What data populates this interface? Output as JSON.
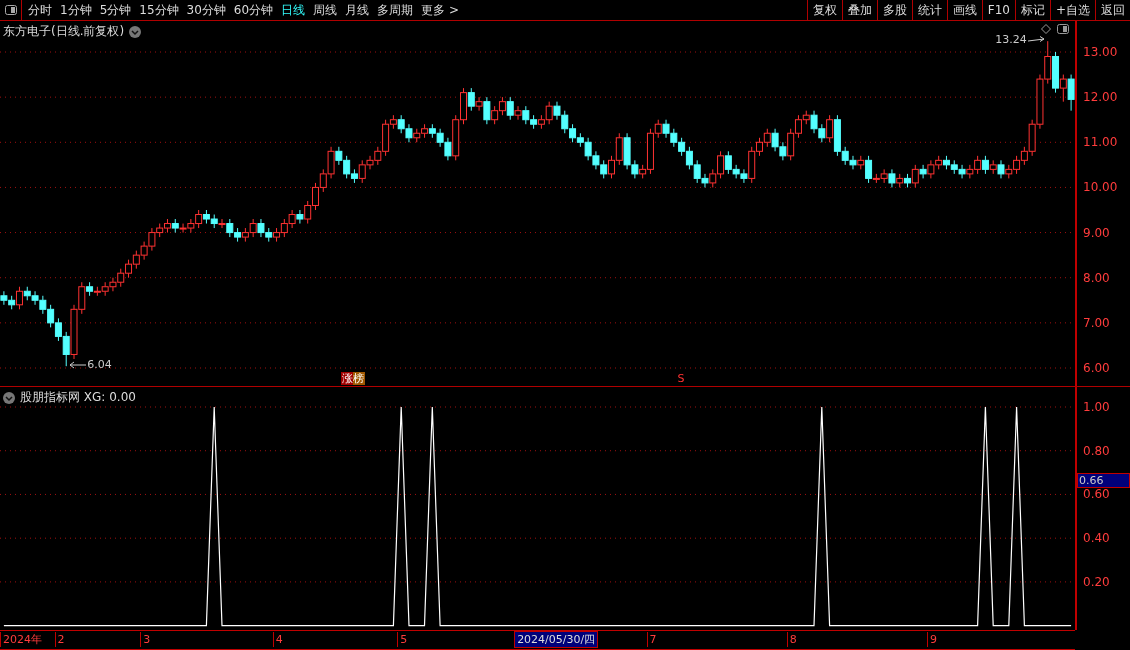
{
  "toolbar": {
    "tabs": [
      {
        "label": "分时",
        "selected": false
      },
      {
        "label": "1分钟",
        "selected": false
      },
      {
        "label": "5分钟",
        "selected": false
      },
      {
        "label": "15分钟",
        "selected": false
      },
      {
        "label": "30分钟",
        "selected": false
      },
      {
        "label": "60分钟",
        "selected": false
      },
      {
        "label": "日线",
        "selected": true
      },
      {
        "label": "周线",
        "selected": false
      },
      {
        "label": "月线",
        "selected": false
      },
      {
        "label": "多周期",
        "selected": false
      },
      {
        "label": "更多 >",
        "selected": false
      }
    ],
    "buttons": [
      "复权",
      "叠加",
      "多股",
      "统计",
      "画线",
      "F10",
      "标记",
      "+自选",
      "返回"
    ]
  },
  "main_chart": {
    "title": "东方电子(日线.前复权)",
    "chart_data": {
      "type": "candlestick",
      "ylim": [
        6,
        13
      ],
      "grid": true,
      "yticks": [
        {
          "value": 13,
          "label": "13.00"
        },
        {
          "value": 12,
          "label": "12.00"
        },
        {
          "value": 11,
          "label": "11.00"
        },
        {
          "value": 10,
          "label": "10.00"
        },
        {
          "value": 9,
          "label": "9.00"
        },
        {
          "value": 8,
          "label": "8.00"
        },
        {
          "value": 7,
          "label": "7.00"
        },
        {
          "value": 6,
          "label": "6.00"
        }
      ],
      "ohlc": [
        [
          7.6,
          7.7,
          7.4,
          7.5
        ],
        [
          7.5,
          7.6,
          7.3,
          7.4
        ],
        [
          7.4,
          7.8,
          7.3,
          7.7
        ],
        [
          7.7,
          7.8,
          7.5,
          7.6
        ],
        [
          7.6,
          7.7,
          7.4,
          7.5
        ],
        [
          7.5,
          7.6,
          7.2,
          7.3
        ],
        [
          7.3,
          7.4,
          6.9,
          7.0
        ],
        [
          7.0,
          7.1,
          6.6,
          6.7
        ],
        [
          6.7,
          6.8,
          6.04,
          6.3
        ],
        [
          6.3,
          7.4,
          6.2,
          7.3
        ],
        [
          7.3,
          7.9,
          7.2,
          7.8
        ],
        [
          7.8,
          7.9,
          7.6,
          7.7
        ],
        [
          7.7,
          7.8,
          7.6,
          7.7
        ],
        [
          7.7,
          7.9,
          7.6,
          7.8
        ],
        [
          7.8,
          8.0,
          7.7,
          7.9
        ],
        [
          7.9,
          8.2,
          7.8,
          8.1
        ],
        [
          8.1,
          8.4,
          8.0,
          8.3
        ],
        [
          8.3,
          8.6,
          8.2,
          8.5
        ],
        [
          8.5,
          8.8,
          8.4,
          8.7
        ],
        [
          8.7,
          9.1,
          8.6,
          9.0
        ],
        [
          9.0,
          9.2,
          8.9,
          9.1
        ],
        [
          9.1,
          9.3,
          9.0,
          9.2
        ],
        [
          9.2,
          9.3,
          9.0,
          9.1
        ],
        [
          9.1,
          9.2,
          9.0,
          9.1
        ],
        [
          9.1,
          9.3,
          9.0,
          9.2
        ],
        [
          9.2,
          9.5,
          9.1,
          9.4
        ],
        [
          9.4,
          9.5,
          9.2,
          9.3
        ],
        [
          9.3,
          9.4,
          9.1,
          9.2
        ],
        [
          9.2,
          9.3,
          9.1,
          9.2
        ],
        [
          9.2,
          9.3,
          8.9,
          9.0
        ],
        [
          9.0,
          9.1,
          8.8,
          8.9
        ],
        [
          8.9,
          9.1,
          8.8,
          9.0
        ],
        [
          9.0,
          9.3,
          8.9,
          9.2
        ],
        [
          9.2,
          9.3,
          8.9,
          9.0
        ],
        [
          9.0,
          9.1,
          8.8,
          8.9
        ],
        [
          8.9,
          9.1,
          8.8,
          9.0
        ],
        [
          9.0,
          9.3,
          8.9,
          9.2
        ],
        [
          9.2,
          9.5,
          9.1,
          9.4
        ],
        [
          9.4,
          9.5,
          9.2,
          9.3
        ],
        [
          9.3,
          9.7,
          9.2,
          9.6
        ],
        [
          9.6,
          10.1,
          9.5,
          10.0
        ],
        [
          10.0,
          10.4,
          9.9,
          10.3
        ],
        [
          10.3,
          10.9,
          10.2,
          10.8
        ],
        [
          10.8,
          10.9,
          10.5,
          10.6
        ],
        [
          10.6,
          10.7,
          10.2,
          10.3
        ],
        [
          10.3,
          10.4,
          10.1,
          10.2
        ],
        [
          10.2,
          10.6,
          10.1,
          10.5
        ],
        [
          10.5,
          10.7,
          10.4,
          10.6
        ],
        [
          10.6,
          10.9,
          10.5,
          10.8
        ],
        [
          10.8,
          11.5,
          10.7,
          11.4
        ],
        [
          11.4,
          11.6,
          11.3,
          11.5
        ],
        [
          11.5,
          11.6,
          11.2,
          11.3
        ],
        [
          11.3,
          11.4,
          11.0,
          11.1
        ],
        [
          11.1,
          11.3,
          11.0,
          11.2
        ],
        [
          11.2,
          11.4,
          11.1,
          11.3
        ],
        [
          11.3,
          11.4,
          11.1,
          11.2
        ],
        [
          11.2,
          11.3,
          10.9,
          11.0
        ],
        [
          11.0,
          11.1,
          10.6,
          10.7
        ],
        [
          10.7,
          11.6,
          10.6,
          11.5
        ],
        [
          11.5,
          12.2,
          11.4,
          12.1
        ],
        [
          12.1,
          12.2,
          11.7,
          11.8
        ],
        [
          11.8,
          12.0,
          11.7,
          11.9
        ],
        [
          11.9,
          12.0,
          11.4,
          11.5
        ],
        [
          11.5,
          11.8,
          11.4,
          11.7
        ],
        [
          11.7,
          12.0,
          11.6,
          11.9
        ],
        [
          11.9,
          12.0,
          11.5,
          11.6
        ],
        [
          11.6,
          11.8,
          11.5,
          11.7
        ],
        [
          11.7,
          11.8,
          11.4,
          11.5
        ],
        [
          11.5,
          11.6,
          11.3,
          11.4
        ],
        [
          11.4,
          11.6,
          11.3,
          11.5
        ],
        [
          11.5,
          11.9,
          11.4,
          11.8
        ],
        [
          11.8,
          11.9,
          11.5,
          11.6
        ],
        [
          11.6,
          11.7,
          11.2,
          11.3
        ],
        [
          11.3,
          11.4,
          11.0,
          11.1
        ],
        [
          11.1,
          11.2,
          10.9,
          11.0
        ],
        [
          11.0,
          11.1,
          10.6,
          10.7
        ],
        [
          10.7,
          10.8,
          10.4,
          10.5
        ],
        [
          10.5,
          10.6,
          10.2,
          10.3
        ],
        [
          10.3,
          10.7,
          10.2,
          10.6
        ],
        [
          10.6,
          11.2,
          10.5,
          11.1
        ],
        [
          11.1,
          11.2,
          10.4,
          10.5
        ],
        [
          10.5,
          10.6,
          10.2,
          10.3
        ],
        [
          10.3,
          10.5,
          10.2,
          10.4
        ],
        [
          10.4,
          11.3,
          10.3,
          11.2
        ],
        [
          11.2,
          11.5,
          11.1,
          11.4
        ],
        [
          11.4,
          11.5,
          11.1,
          11.2
        ],
        [
          11.2,
          11.3,
          10.9,
          11.0
        ],
        [
          11.0,
          11.1,
          10.7,
          10.8
        ],
        [
          10.8,
          10.9,
          10.4,
          10.5
        ],
        [
          10.5,
          10.6,
          10.1,
          10.2
        ],
        [
          10.2,
          10.3,
          10.0,
          10.1
        ],
        [
          10.1,
          10.4,
          10.0,
          10.3
        ],
        [
          10.3,
          10.8,
          10.2,
          10.7
        ],
        [
          10.7,
          10.8,
          10.3,
          10.4
        ],
        [
          10.4,
          10.5,
          10.2,
          10.3
        ],
        [
          10.3,
          10.4,
          10.1,
          10.2
        ],
        [
          10.2,
          10.9,
          10.1,
          10.8
        ],
        [
          10.8,
          11.1,
          10.7,
          11.0
        ],
        [
          11.0,
          11.3,
          10.9,
          11.2
        ],
        [
          11.2,
          11.3,
          10.8,
          10.9
        ],
        [
          10.9,
          11.0,
          10.6,
          10.7
        ],
        [
          10.7,
          11.3,
          10.6,
          11.2
        ],
        [
          11.2,
          11.6,
          11.1,
          11.5
        ],
        [
          11.5,
          11.7,
          11.4,
          11.6
        ],
        [
          11.6,
          11.7,
          11.2,
          11.3
        ],
        [
          11.3,
          11.4,
          11.0,
          11.1
        ],
        [
          11.1,
          11.6,
          11.0,
          11.5
        ],
        [
          11.5,
          11.6,
          10.7,
          10.8
        ],
        [
          10.8,
          10.9,
          10.5,
          10.6
        ],
        [
          10.6,
          10.7,
          10.4,
          10.5
        ],
        [
          10.5,
          10.7,
          10.4,
          10.6
        ],
        [
          10.6,
          10.7,
          10.1,
          10.2
        ],
        [
          10.2,
          10.3,
          10.1,
          10.2
        ],
        [
          10.2,
          10.4,
          10.1,
          10.3
        ],
        [
          10.3,
          10.4,
          10.0,
          10.1
        ],
        [
          10.1,
          10.3,
          10.0,
          10.2
        ],
        [
          10.2,
          10.3,
          10.0,
          10.1
        ],
        [
          10.1,
          10.5,
          10.0,
          10.4
        ],
        [
          10.4,
          10.5,
          10.2,
          10.3
        ],
        [
          10.3,
          10.6,
          10.2,
          10.5
        ],
        [
          10.5,
          10.7,
          10.4,
          10.6
        ],
        [
          10.6,
          10.7,
          10.4,
          10.5
        ],
        [
          10.5,
          10.6,
          10.3,
          10.4
        ],
        [
          10.4,
          10.5,
          10.2,
          10.3
        ],
        [
          10.3,
          10.5,
          10.2,
          10.4
        ],
        [
          10.4,
          10.7,
          10.3,
          10.6
        ],
        [
          10.6,
          10.7,
          10.3,
          10.4
        ],
        [
          10.4,
          10.6,
          10.3,
          10.5
        ],
        [
          10.5,
          10.6,
          10.2,
          10.3
        ],
        [
          10.3,
          10.5,
          10.2,
          10.4
        ],
        [
          10.4,
          10.7,
          10.3,
          10.6
        ],
        [
          10.6,
          10.9,
          10.5,
          10.8
        ],
        [
          10.8,
          11.5,
          10.7,
          11.4
        ],
        [
          11.4,
          12.5,
          11.3,
          12.4
        ],
        [
          12.4,
          13.24,
          12.3,
          12.9
        ],
        [
          12.9,
          13.0,
          12.1,
          12.2
        ],
        [
          12.2,
          12.5,
          11.9,
          12.4
        ],
        [
          12.4,
          12.5,
          11.7,
          11.95
        ]
      ],
      "annotations": [
        "13.24",
        "6.04"
      ]
    },
    "signals": [
      {
        "kind": "badge",
        "label": "涨榜"
      },
      {
        "kind": "letter",
        "label": "S"
      }
    ]
  },
  "indicator": {
    "title": "股朋指标网 XG: 0.00",
    "cursor_value": "0.66",
    "chart_data": {
      "type": "line",
      "ylim": [
        -0.02,
        1
      ],
      "grid": true,
      "yticks": [
        {
          "value": 1,
          "label": "1.00"
        },
        {
          "value": 0.8,
          "label": "0.80"
        },
        {
          "value": 0.6,
          "label": "0.60"
        },
        {
          "value": 0.4,
          "label": "0.40"
        },
        {
          "value": 0.2,
          "label": "0.20"
        }
      ],
      "series": [
        {
          "color": "#ffffff",
          "values": [
            0,
            0,
            0,
            0,
            0,
            0,
            0,
            0,
            0,
            0,
            0,
            0,
            0,
            0,
            0,
            0,
            0,
            0,
            0,
            0,
            0,
            0,
            0,
            0,
            0,
            0,
            0,
            1,
            0,
            0,
            0,
            0,
            0,
            0,
            0,
            0,
            0,
            0,
            0,
            0,
            0,
            0,
            0,
            0,
            0,
            0,
            0,
            0,
            0,
            0,
            0,
            1,
            0,
            0,
            0,
            1,
            0,
            0,
            0,
            0,
            0,
            0,
            0,
            0,
            0,
            0,
            0,
            0,
            0,
            0,
            0,
            0,
            0,
            0,
            0,
            0,
            0,
            0,
            0,
            0,
            0,
            0,
            0,
            0,
            0,
            0,
            0,
            0,
            0,
            0,
            0,
            0,
            0,
            0,
            0,
            0,
            0,
            0,
            0,
            0,
            0,
            0,
            0,
            0,
            0,
            1,
            0,
            0,
            0,
            0,
            0,
            0,
            0,
            0,
            0,
            0,
            0,
            0,
            0,
            0,
            0,
            0,
            0,
            0,
            0,
            0,
            1,
            0,
            0,
            0,
            1,
            0,
            0,
            0,
            0,
            0,
            0,
            0
          ]
        }
      ]
    }
  },
  "x_axis": [
    {
      "label": "2024年",
      "selected": false
    },
    {
      "label": "2",
      "selected": false
    },
    {
      "label": "3",
      "selected": false
    },
    {
      "label": "4",
      "selected": false
    },
    {
      "label": "5",
      "selected": false
    },
    {
      "label": "2024/05/30/四",
      "selected": true
    },
    {
      "label": "7",
      "selected": false
    },
    {
      "label": "8",
      "selected": false
    },
    {
      "label": "9",
      "selected": false
    }
  ]
}
